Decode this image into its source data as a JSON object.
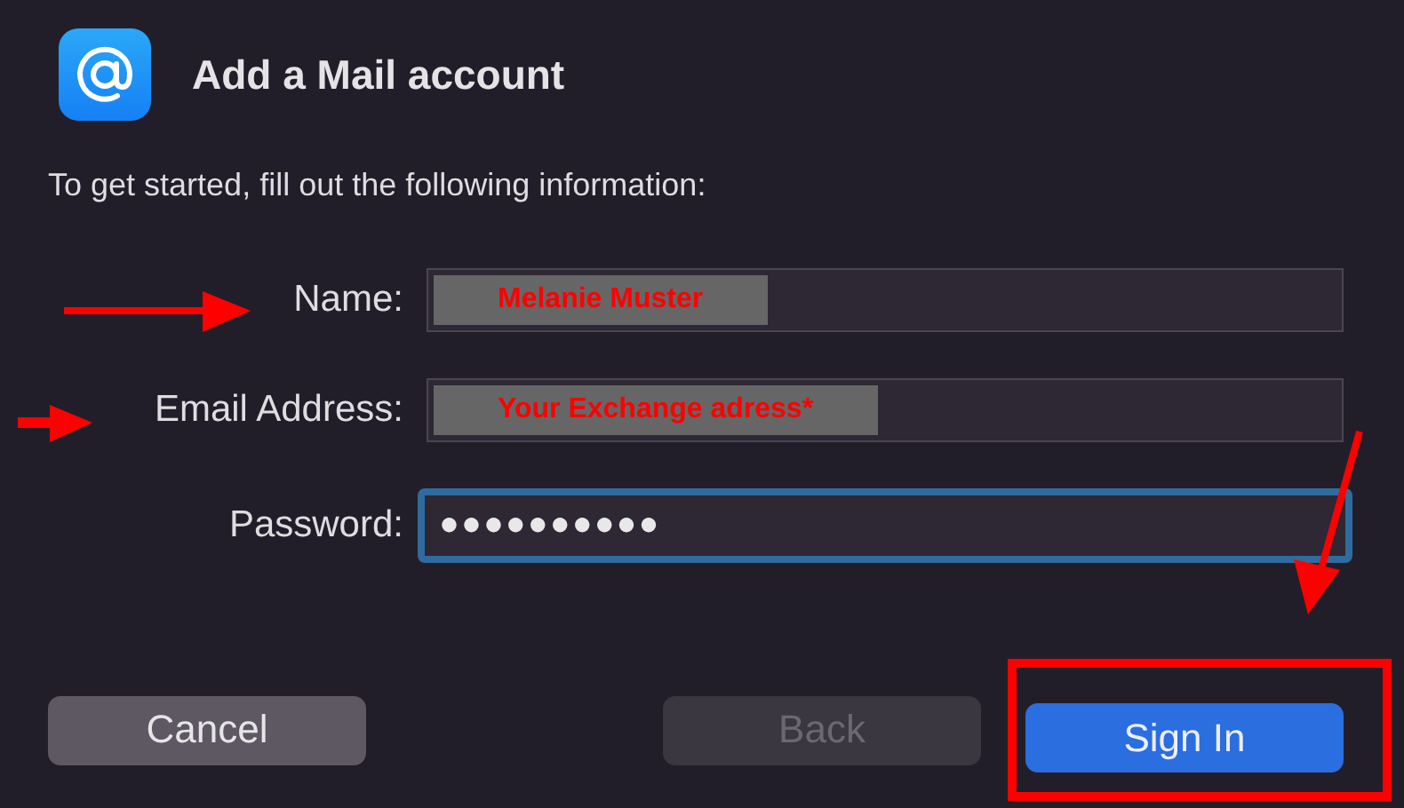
{
  "dialog": {
    "title": "Add a Mail account",
    "instruction": "To get started, fill out the following information:"
  },
  "fields": [
    {
      "label": "Name:",
      "value": "Melanie Muster",
      "kind": "redacted",
      "focused": false
    },
    {
      "label": "Email Address:",
      "value": "Your Exchange adress*",
      "kind": "redacted",
      "focused": false
    },
    {
      "label": "Password:",
      "value": "●●●●●●●●●●",
      "kind": "password",
      "focused": true
    }
  ],
  "buttons": [
    {
      "label": "Cancel",
      "kind": "normal",
      "disabled": false
    },
    {
      "label": "Back",
      "kind": "normal",
      "disabled": true
    },
    {
      "label": "Sign In",
      "kind": "primary",
      "disabled": false,
      "highlighted": true
    }
  ]
}
